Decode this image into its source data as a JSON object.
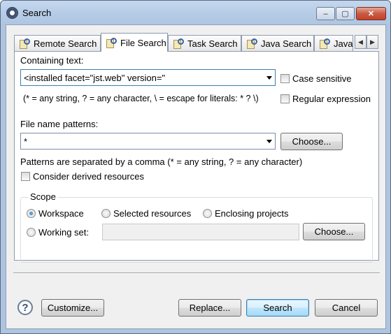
{
  "window": {
    "title": "Search"
  },
  "titlebar_buttons": {
    "minimize": "–",
    "maximize": "▢",
    "close": "✕"
  },
  "tabs": [
    {
      "label": "Remote Search",
      "active": false
    },
    {
      "label": "File Search",
      "active": true
    },
    {
      "label": "Task Search",
      "active": false
    },
    {
      "label": "Java Search",
      "active": false
    },
    {
      "label": "Java",
      "active": false
    }
  ],
  "tab_scroll": {
    "left": "◀",
    "right": "▶"
  },
  "containing_text": {
    "label": "Containing text:",
    "value": "<installed facet=\"jst.web\" version=\"",
    "case_sensitive_label": "Case sensitive",
    "case_sensitive": false,
    "regex_label": "Regular expression",
    "regex": false,
    "hint": "(* = any string, ? = any character, \\ = escape for literals: * ? \\)"
  },
  "file_name_patterns": {
    "label": "File name patterns:",
    "value": "*",
    "choose_label": "Choose...",
    "hint": "Patterns are separated by a comma (* = any string, ? = any character)"
  },
  "derived": {
    "label": "Consider derived resources",
    "checked": false
  },
  "scope": {
    "title": "Scope",
    "options": {
      "workspace": "Workspace",
      "selected": "Selected resources",
      "enclosing": "Enclosing projects",
      "working_set": "Working set:"
    },
    "selected_option": "Workspace",
    "working_set_value": "",
    "choose_label": "Choose..."
  },
  "footer": {
    "help_glyph": "?",
    "customize_label": "Customize...",
    "replace_label": "Replace...",
    "search_label": "Search",
    "cancel_label": "Cancel"
  }
}
